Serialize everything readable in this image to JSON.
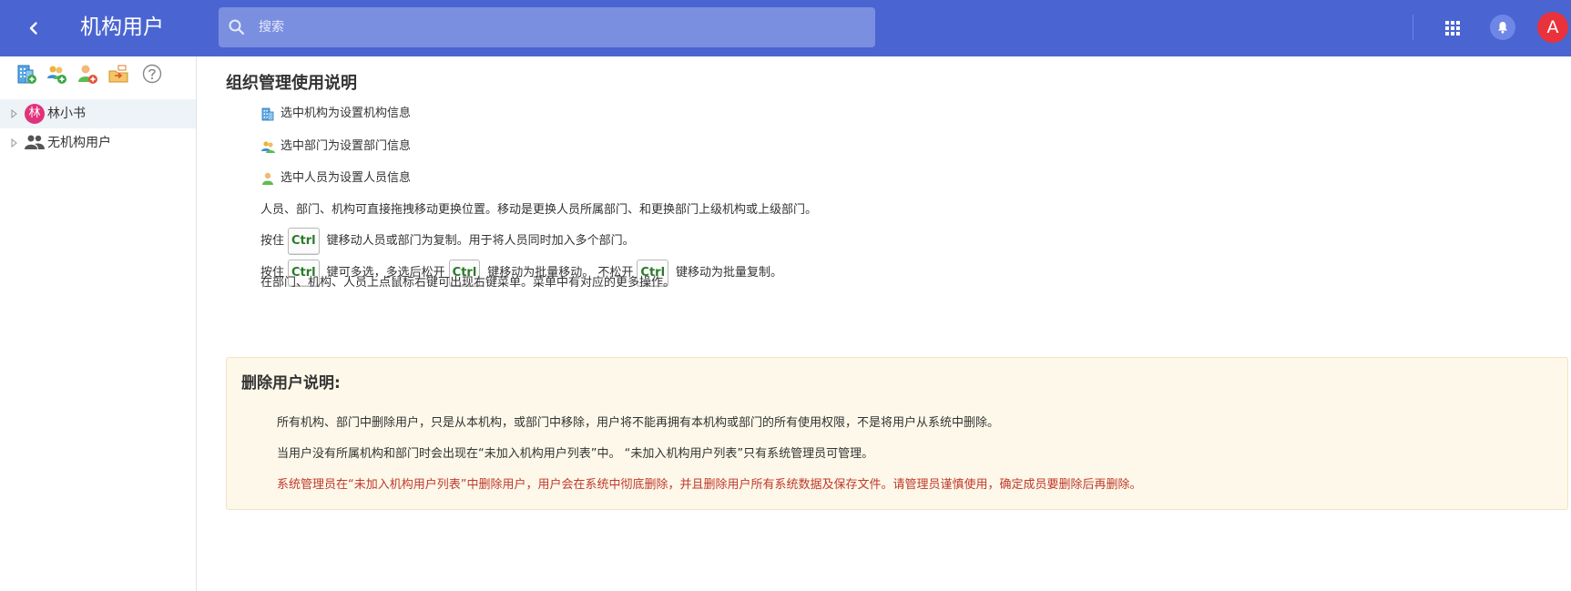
{
  "header": {
    "title": "机构用户",
    "search_placeholder": "搜索",
    "avatar_letter": "A",
    "bg_color": "#4a65d2"
  },
  "sidebar": {
    "toolbar": [
      {
        "name": "add-organization",
        "icon": "building-plus-icon"
      },
      {
        "name": "add-department",
        "icon": "group-plus-icon"
      },
      {
        "name": "add-user",
        "icon": "user-plus-icon"
      },
      {
        "name": "move",
        "icon": "folder-move-icon"
      },
      {
        "name": "help",
        "icon": "question-icon"
      }
    ],
    "tree": [
      {
        "label": "林小书",
        "avatar_text": "林",
        "selected": true
      },
      {
        "label": "无机构用户",
        "icon": "people-icon",
        "selected": false
      }
    ]
  },
  "main": {
    "section_title": "组织管理使用说明",
    "icon_lines": [
      {
        "icon": "building-icon",
        "text": "选中机构为设置机构信息"
      },
      {
        "icon": "group-icon",
        "text": "选中部门为设置部门信息"
      },
      {
        "icon": "person-icon",
        "text": "选中人员为设置人员信息"
      }
    ],
    "drag_line": "人员、部门、机构可直接拖拽移动更换位置。移动是更换人员所属部门、和更换部门上级机构或上级部门。",
    "ctrl_key": "Ctrl",
    "copy_line": {
      "prefix": "按住",
      "suffix": "键移动人员或部门为复制。用于将人员同时加入多个部门。"
    },
    "multi_line": {
      "prefix": "按住",
      "middle1": "键可多选，多选后松开",
      "middle2": "键移动为批量移动。 不松开",
      "suffix": "键移动为批量复制。"
    },
    "context_line": "在部门、机构、人员上点鼠标右键可出现右键菜单。菜单中有对应的更多操作。"
  },
  "notice": {
    "title": "删除用户说明:",
    "lines": [
      "所有机构、部门中删除用户，只是从本机构，或部门中移除，用户将不能再拥有本机构或部门的所有使用权限，不是将用户从系统中删除。",
      "当用户没有所属机构和部门时会出现在“未加入机构用户列表”中。 “未加入机构用户列表”只有系统管理员可管理。"
    ],
    "warning": "系统管理员在“未加入机构用户列表”中删除用户，用户会在系统中彻底删除，并且删除用户所有系统数据及保存文件。请管理员谨慎使用，确定成员要删除后再删除。",
    "bg_color": "#fdf8e9",
    "warning_color": "#c0392b"
  }
}
